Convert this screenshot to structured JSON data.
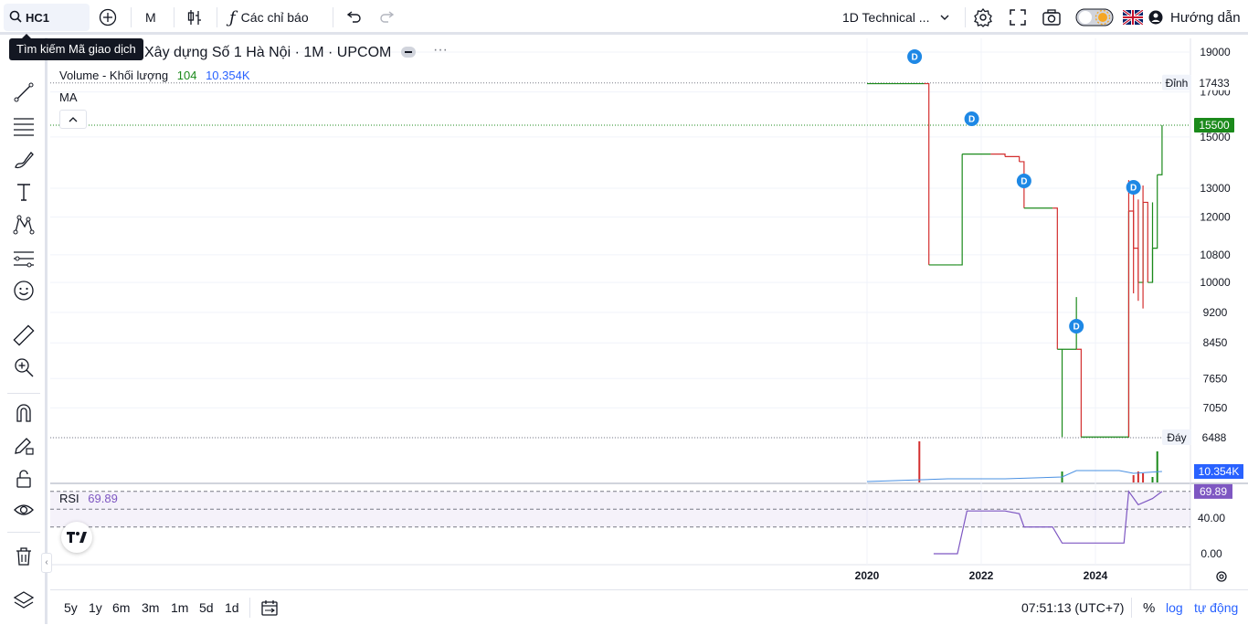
{
  "toolbar": {
    "symbol": "HC1",
    "interval": "M",
    "indicators_label": "Các chỉ báo",
    "layout_label": "1D Technical ...",
    "guide_label": "Hướng dẫn",
    "search_tooltip": "Tìm kiếm Mã giao dịch"
  },
  "legend": {
    "title": "Xây dựng Số 1 Hà Nội · 1M · UPCOM",
    "volume_name": "Volume - Khối lượng",
    "volume_value": "104",
    "volume_ma": "10.354K",
    "ma_label": "MA",
    "rsi_name": "RSI",
    "rsi_value": "69.89"
  },
  "bottombar": {
    "ranges": [
      "5y",
      "1y",
      "6m",
      "3m",
      "1m",
      "5d",
      "1d"
    ],
    "time": "07:51:13 (UTC+7)",
    "percent": "%",
    "log": "log",
    "auto": "tự động"
  },
  "colors": {
    "up": "#089981",
    "down": "#d32f2f",
    "up_line": "#1b8a1b",
    "rsi": "#7e57c2",
    "volume_ma": "#4a90e2",
    "accent": "#2962ff",
    "dividend_marker": "#1e88e5"
  },
  "chart_data": {
    "type": "line",
    "price_axis": {
      "scale": "log",
      "ticks": [
        "19000",
        "17000",
        "15000",
        "13000",
        "12000",
        "10800",
        "10000",
        "9200",
        "8450",
        "7650",
        "7050",
        "6488"
      ],
      "labels": {
        "high_label": "Đỉnh",
        "high_value": "17433",
        "low_label": "Đáy",
        "low_value": "6488",
        "last_value": "15500",
        "volume_ma_value": "10.354K"
      }
    },
    "x_ticks": [
      "2020",
      "2022",
      "2024"
    ],
    "price_series": [
      {
        "x": "2020-01",
        "y": 17400
      },
      {
        "x": "2021-01",
        "y": 17400
      },
      {
        "x": "2021-02",
        "y": 10500
      },
      {
        "x": "2021-08",
        "y": 10500
      },
      {
        "x": "2021-09",
        "y": 14300
      },
      {
        "x": "2022-03",
        "y": 14300
      },
      {
        "x": "2022-06",
        "y": 14200
      },
      {
        "x": "2022-09",
        "y": 14000
      },
      {
        "x": "2022-10",
        "y": 12300
      },
      {
        "x": "2023-04",
        "y": 12300
      },
      {
        "x": "2023-05",
        "y": 8300
      },
      {
        "x": "2023-09",
        "y": 8300
      },
      {
        "x": "2023-10",
        "y": 6500
      },
      {
        "x": "2024-07",
        "y": 6500
      },
      {
        "x": "2024-08",
        "y": 12200
      },
      {
        "x": "2024-09",
        "y": 11000
      },
      {
        "x": "2024-10",
        "y": 10000
      },
      {
        "x": "2024-11",
        "y": 12500
      },
      {
        "x": "2024-12",
        "y": 10000
      },
      {
        "x": "2025-01",
        "y": 11000
      },
      {
        "x": "2025-02",
        "y": 13500
      },
      {
        "x": "2025-03",
        "y": 15500
      }
    ],
    "dividend_markers": [
      {
        "x": "2020-11",
        "label": "D"
      },
      {
        "x": "2021-11",
        "label": "D"
      },
      {
        "x": "2022-10",
        "label": "D"
      },
      {
        "x": "2023-09",
        "label": "D"
      },
      {
        "x": "2024-09",
        "label": "D"
      }
    ],
    "rsi": {
      "ticks": [
        "40.00",
        "0.00"
      ],
      "last": "69.89",
      "values": [
        {
          "x": "2021-03",
          "y": 0
        },
        {
          "x": "2021-08",
          "y": 0
        },
        {
          "x": "2021-10",
          "y": 48
        },
        {
          "x": "2022-06",
          "y": 48
        },
        {
          "x": "2022-09",
          "y": 45
        },
        {
          "x": "2022-10",
          "y": 30
        },
        {
          "x": "2023-04",
          "y": 30
        },
        {
          "x": "2023-06",
          "y": 12
        },
        {
          "x": "2024-07",
          "y": 12
        },
        {
          "x": "2024-08",
          "y": 70
        },
        {
          "x": "2024-10",
          "y": 55
        },
        {
          "x": "2025-01",
          "y": 62
        },
        {
          "x": "2025-03",
          "y": 69.89
        }
      ]
    }
  }
}
